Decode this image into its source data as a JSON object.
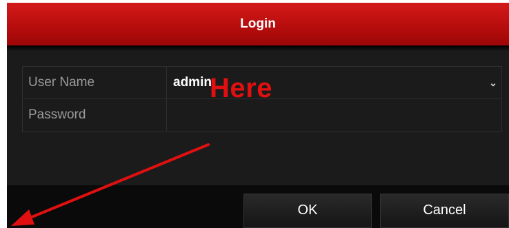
{
  "dialog": {
    "title": "Login"
  },
  "form": {
    "username_label": "User Name",
    "username_value": "admin",
    "password_label": "Password",
    "password_value": ""
  },
  "buttons": {
    "ok_label": "OK",
    "cancel_label": "Cancel"
  },
  "annotation": {
    "text": "Here",
    "color": "#e01010"
  },
  "icons": {
    "username_dropdown": "chevron-down-icon"
  },
  "colors": {
    "title_bar": "#c41313",
    "dialog_background": "#1b1b1b",
    "footer_background": "#0a0a0a"
  }
}
